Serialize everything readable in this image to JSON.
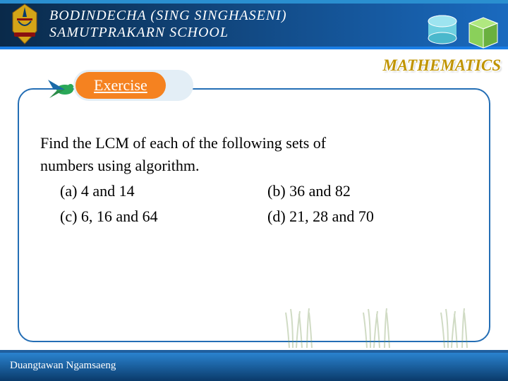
{
  "header": {
    "school_line1": "BODINDECHA (SING SINGHASENI)",
    "school_line2": "SAMUTPRAKARN SCHOOL",
    "subject": "MATHEMATICS"
  },
  "exercise": {
    "label": "Exercise",
    "prompt_line1": "Find the LCM of each of the following sets of",
    "prompt_line2": "numbers using algorithm.",
    "options": {
      "a": "(a)  4 and 14",
      "b": "(b)  36 and 82",
      "c": "(c)  6, 16 and 64",
      "d": "(d)  21, 28 and 70"
    }
  },
  "footer": {
    "author": "Duangtawan Ngamsaeng"
  },
  "colors": {
    "accent": "#f58220",
    "border": "#246eb5",
    "header_grad_start": "#0a2a4a",
    "header_grad_end": "#1a6abf"
  }
}
